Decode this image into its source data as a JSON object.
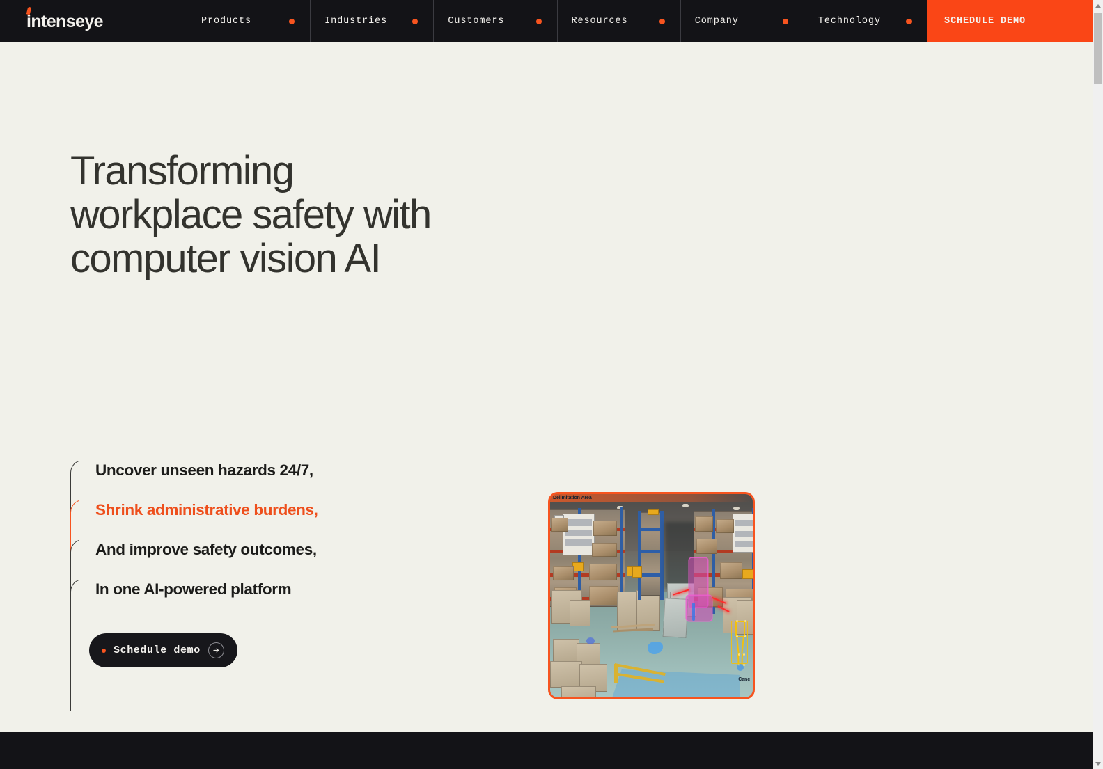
{
  "brand": {
    "logo_text": "intenseye",
    "accent_color": "#FA4616",
    "dark_color": "#131317",
    "page_background": "#F1F1EA",
    "heading_color": "#33332E"
  },
  "navbar": {
    "items": [
      {
        "label": "Products",
        "dot": true
      },
      {
        "label": "Industries",
        "dot": true
      },
      {
        "label": "Customers",
        "dot": true
      },
      {
        "label": "Resources",
        "dot": true
      },
      {
        "label": "Company",
        "dot": true
      },
      {
        "label": "Technology",
        "dot": true
      }
    ],
    "cta_label": "SCHEDULE DEMO"
  },
  "hero": {
    "title_lines": [
      "Transforming",
      "workplace safety with",
      "computer vision AI"
    ],
    "claims": [
      {
        "text": "Uncover unseen hazards 24/7,",
        "active": false
      },
      {
        "text": "Shrink administrative burdens,",
        "active": true
      },
      {
        "text": "And improve safety outcomes,",
        "active": false
      },
      {
        "text": "In one AI-powered platform",
        "active": false
      }
    ],
    "cta": {
      "label": "Schedule demo",
      "arrow_icon": "arrow-right-circle-icon",
      "dot_color": "#F7541F"
    }
  },
  "cctv": {
    "alt": "Warehouse aisle CCTV frame with AI computer-vision detection overlays",
    "overlay_labels": {
      "top_left": "Delimitation Area",
      "bottom_right": "Canc"
    },
    "detections": [
      {
        "type": "segmentation",
        "color": "#D64ABA",
        "subject": "forklift"
      },
      {
        "type": "pose-skeleton",
        "color": "#F2C00E",
        "subject": "worker"
      },
      {
        "type": "zone",
        "color": "#60A8D6",
        "subject": "floor-zone"
      },
      {
        "type": "laser-line",
        "color": "#FF2B2B",
        "subject": "boundary"
      }
    ]
  },
  "scrollbar": {
    "up_arrow": "scroll-up-arrow-icon",
    "down_arrow": "scroll-down-arrow-icon",
    "thumb_position_percent": 2
  }
}
